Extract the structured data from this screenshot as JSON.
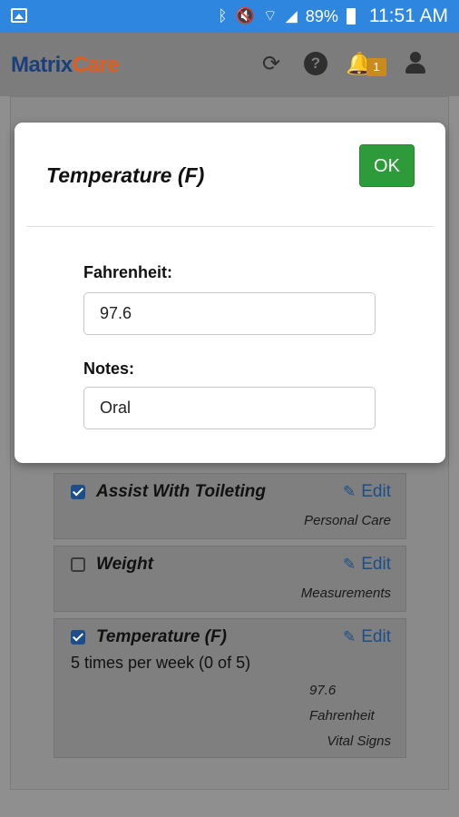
{
  "status_bar": {
    "battery": "89%",
    "time": "11:51 AM",
    "icons": [
      "image-icon",
      "bluetooth-icon",
      "mute-icon",
      "wifi-icon",
      "signal-icon",
      "battery-icon"
    ]
  },
  "header": {
    "logo_part1": "Matrix",
    "logo_part2": "Care",
    "notification_count": "1",
    "icons": [
      "refresh-icon",
      "help-icon",
      "bell-icon",
      "user-icon"
    ]
  },
  "dialog": {
    "title": "Temperature (F)",
    "ok_label": "OK",
    "fields": [
      {
        "label": "Fahrenheit:",
        "value": "97.6"
      },
      {
        "label": "Notes:",
        "value": "Oral"
      }
    ]
  },
  "tasks": [
    {
      "title": "Assist With Toileting",
      "checked": true,
      "edit_label": "Edit",
      "category": "Personal Care"
    },
    {
      "title": "Weight",
      "checked": false,
      "edit_label": "Edit",
      "category": "Measurements"
    },
    {
      "title": "Temperature (F)",
      "checked": true,
      "edit_label": "Edit",
      "frequency": "5 times per week (0 of 5)",
      "reading_value": "97.6",
      "reading_unit": "Fahrenheit",
      "category": "Vital Signs"
    }
  ],
  "colors": {
    "status_bar": "#2e86de",
    "brand_blue": "#1b3f7a",
    "brand_orange": "#e55b1a",
    "ok_green": "#2e9b3a",
    "link_blue": "#1d4e8a"
  }
}
